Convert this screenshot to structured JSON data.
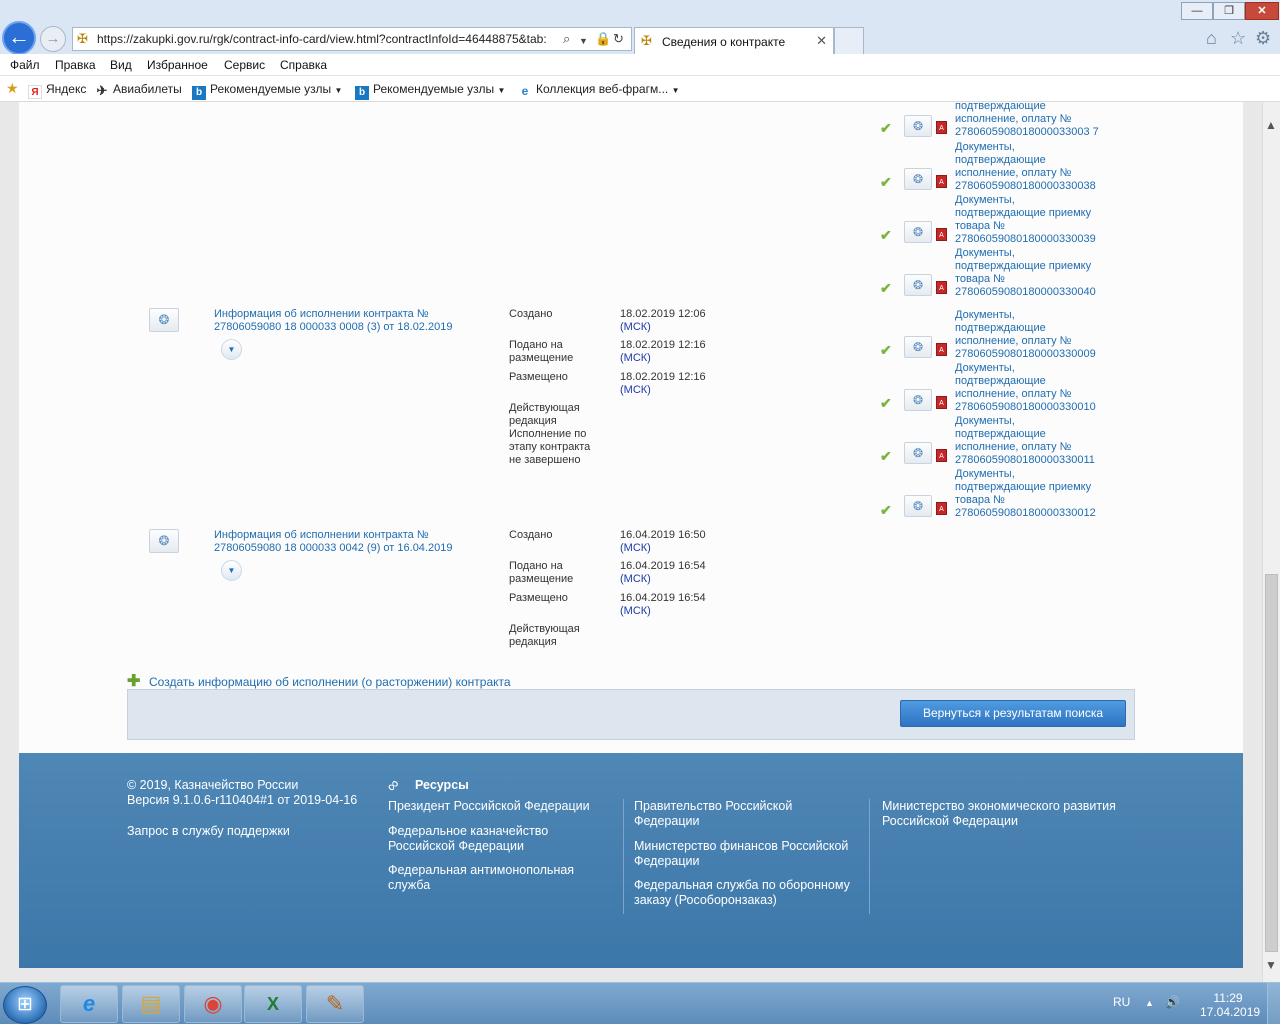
{
  "browser": {
    "url": "https://zakupki.gov.ru/rgk/contract-info-card/view.html?contractInfoId=46448875&tab:",
    "tab_title": "Сведения о контракте",
    "menu": [
      "Файл",
      "Правка",
      "Вид",
      "Избранное",
      "Сервис",
      "Справка"
    ],
    "favorites": [
      "Яндекс",
      "Авиабилеты",
      "Рекомендуемые узлы",
      "Рекомендуемые узлы",
      "Коллекция веб-фрагм..."
    ]
  },
  "documents_top": [
    {
      "text": "подтверждающие исполнение, оплату № 2780605908018000033003 7"
    },
    {
      "text": "Документы, подтверждающие исполнение, оплату № 27806059080180000330038"
    },
    {
      "text": "Документы, подтверждающие приемку товара № 27806059080180000330039"
    },
    {
      "text": "Документы, подтверждающие приемку товара № 27806059080180000330040"
    }
  ],
  "records": [
    {
      "title": "Информация об исполнении контракта № 27806059080 18 000033 0008 (3) от 18.02.2019",
      "statuses": [
        {
          "label": "Создано",
          "date": "18.02.2019 12:06",
          "tz": "(МСК)"
        },
        {
          "label": "Подано на размещение",
          "date": "18.02.2019 12:16",
          "tz": "(МСК)"
        },
        {
          "label": "Размещено",
          "date": "18.02.2019 12:16",
          "tz": "(МСК)"
        },
        {
          "label": "Действующая редакция Исполнение по этапу контракта не завершено",
          "date": "",
          "tz": ""
        }
      ],
      "documents": [
        {
          "text": "Документы, подтверждающие исполнение, оплату № 27806059080180000330009"
        },
        {
          "text": "Документы, подтверждающие исполнение, оплату № 27806059080180000330010"
        },
        {
          "text": "Документы, подтверждающие исполнение, оплату № 27806059080180000330011"
        },
        {
          "text": "Документы, подтверждающие приемку товара № 27806059080180000330012"
        }
      ]
    },
    {
      "title": "Информация об исполнении контракта № 27806059080 18 000033 0042 (9) от 16.04.2019",
      "statuses": [
        {
          "label": "Создано",
          "date": "16.04.2019 16:50",
          "tz": "(МСК)"
        },
        {
          "label": "Подано на размещение",
          "date": "16.04.2019 16:54",
          "tz": "(МСК)"
        },
        {
          "label": "Размещено",
          "date": "16.04.2019 16:54",
          "tz": "(МСК)"
        },
        {
          "label": "Действующая редакция",
          "date": "",
          "tz": ""
        }
      ]
    }
  ],
  "actions": {
    "create_link": "Создать информацию об исполнении (о расторжении) контракта",
    "return_button": "Вернуться к результатам поиска"
  },
  "footer": {
    "copyright": "© 2019, Казначейство России",
    "version": "Версия 9.1.0.6-r110404#1 от 2019-04-16",
    "support": "Запрос в службу поддержки",
    "resources_title": "Ресурсы",
    "links": [
      "Президент Российской Федерации",
      "Федеральное казначейство Российской Федерации",
      "Федеральная антимонопольная служба",
      "Правительство Российской Федерации",
      "Министерство финансов Российской Федерации",
      "Федеральная служба по оборонному заказу (Рособоронзаказ)",
      "Министерство экономического развития Российской Федерации"
    ]
  },
  "taskbar": {
    "lang": "RU",
    "time": "11:29",
    "date": "17.04.2019"
  }
}
